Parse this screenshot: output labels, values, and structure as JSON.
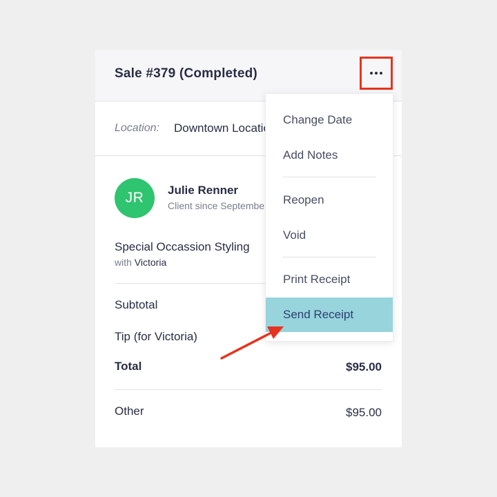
{
  "sale": {
    "title": "Sale #379 (Completed)",
    "more_icon": "more-horizontal-icon"
  },
  "location": {
    "label": "Location:",
    "value": "Downtown Location"
  },
  "client": {
    "initials": "JR",
    "name": "Julie Renner",
    "since": "Client since September"
  },
  "service": {
    "name": "Special Occassion Styling",
    "with_label": "with",
    "staff": "Victoria"
  },
  "totals": {
    "subtotal_label": "Subtotal",
    "tip_label": "Tip (for Victoria)",
    "total_label": "Total",
    "total_value": "$95.00",
    "other_label": "Other",
    "other_value": "$95.00"
  },
  "menu": {
    "items": [
      {
        "label": "Change Date"
      },
      {
        "label": "Add Notes"
      },
      {
        "label": "Reopen"
      },
      {
        "label": "Void"
      },
      {
        "label": "Print Receipt"
      },
      {
        "label": "Send Receipt"
      }
    ]
  },
  "colors": {
    "highlight_box": "#e8321e",
    "avatar": "#2fc46f",
    "menu_hover": "#97d4dc",
    "annotation_arrow": "#e8321e"
  }
}
